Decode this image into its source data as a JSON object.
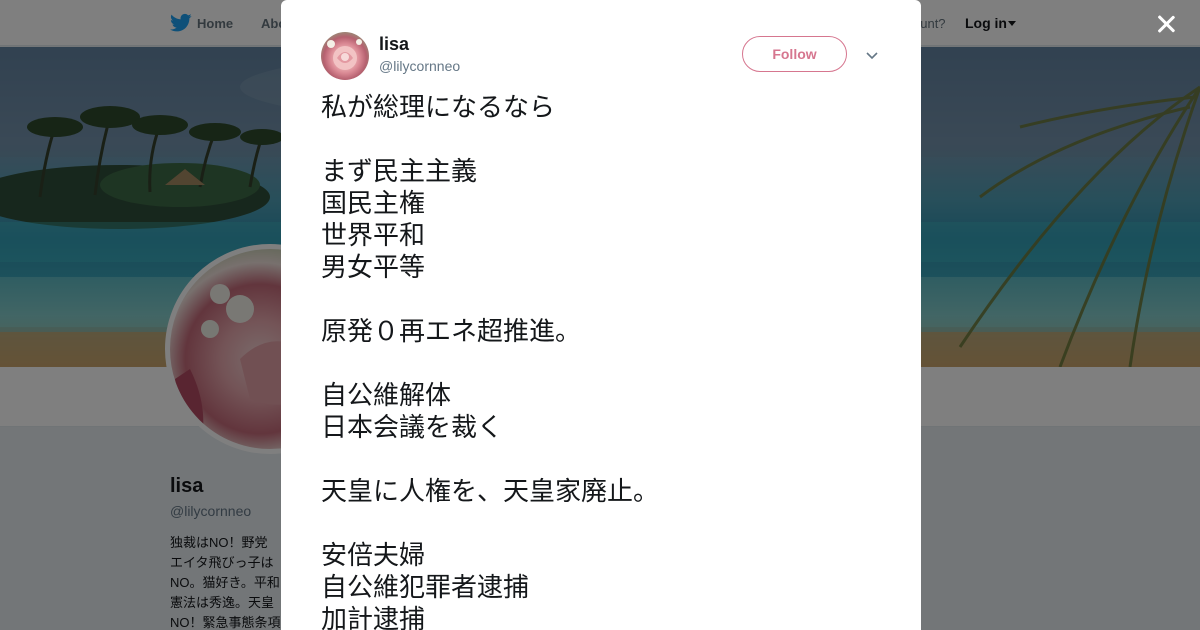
{
  "header": {
    "nav_home": "Home",
    "nav_about": "Abo",
    "have_account": "ccount?",
    "login": "Log in",
    "accent_color": "#1da1f2"
  },
  "profile": {
    "name": "lisa",
    "handle": "@lilycornneo",
    "bio_lines": [
      "独裁はNO！野党",
      "エイタ飛びっ子は",
      "NO。猫好き。平和",
      "憲法は秀逸。天皇",
      "NO！緊急事態条項"
    ]
  },
  "tweet": {
    "author_name": "lisa",
    "author_handle": "@lilycornneo",
    "follow_label": "Follow",
    "follow_color": "#d6768f",
    "lines": [
      "私が総理になるなら",
      "",
      "まず民主主義",
      "国民主権",
      "世界平和",
      "男女平等",
      "",
      "原発０再エネ超推進。",
      "",
      "自公維解体",
      "日本会議を裁く",
      "",
      "天皇に人権を、天皇家廃止。",
      "",
      "安倍夫婦",
      "自公維犯罪者逮捕",
      "加計逮捕"
    ]
  }
}
